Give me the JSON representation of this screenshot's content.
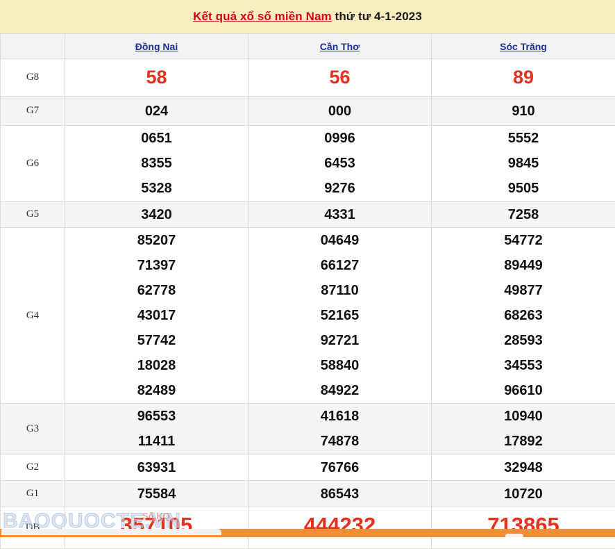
{
  "header": {
    "title_link": "Kết quả xổ số miền Nam",
    "title_rest": " thứ tư 4-1-2023",
    "background_color": "#faeec0",
    "link_color": "#d0021b"
  },
  "table": {
    "corner_label": "",
    "columns": [
      "Đồng Nai",
      "Cần Thơ",
      "Sóc Trăng"
    ],
    "column_link_color": "#1a2e9c",
    "highlight_color": "#e8301c",
    "rows": [
      {
        "prize": "G8",
        "cells": [
          [
            "58"
          ],
          [
            "56"
          ],
          [
            "89"
          ]
        ]
      },
      {
        "prize": "G7",
        "cells": [
          [
            "024"
          ],
          [
            "000"
          ],
          [
            "910"
          ]
        ]
      },
      {
        "prize": "G6",
        "cells": [
          [
            "0651",
            "8355",
            "5328"
          ],
          [
            "0996",
            "6453",
            "9276"
          ],
          [
            "5552",
            "9845",
            "9505"
          ]
        ]
      },
      {
        "prize": "G5",
        "cells": [
          [
            "3420"
          ],
          [
            "4331"
          ],
          [
            "7258"
          ]
        ]
      },
      {
        "prize": "G4",
        "cells": [
          [
            "85207",
            "71397",
            "62778",
            "43017",
            "57742",
            "18028",
            "82489"
          ],
          [
            "04649",
            "66127",
            "87110",
            "52165",
            "92721",
            "58840",
            "84922"
          ],
          [
            "54772",
            "89449",
            "49877",
            "68263",
            "28593",
            "34553",
            "96610"
          ]
        ]
      },
      {
        "prize": "G3",
        "cells": [
          [
            "96553",
            "11411"
          ],
          [
            "41618",
            "74878"
          ],
          [
            "10940",
            "17892"
          ]
        ]
      },
      {
        "prize": "G2",
        "cells": [
          [
            "63931"
          ],
          [
            "76766"
          ],
          [
            "32948"
          ]
        ]
      },
      {
        "prize": "G1",
        "cells": [
          [
            "75584"
          ],
          [
            "86543"
          ],
          [
            "10720"
          ]
        ]
      },
      {
        "prize": "DB",
        "cells": [
          [
            "357105"
          ],
          [
            "444232"
          ],
          [
            "713865"
          ]
        ]
      }
    ]
  },
  "watermark": {
    "text": "BAOQUOCTE.VN",
    "overlay_text": "Số KQ"
  },
  "bottom_bar": {
    "color": "#ef8f38"
  }
}
